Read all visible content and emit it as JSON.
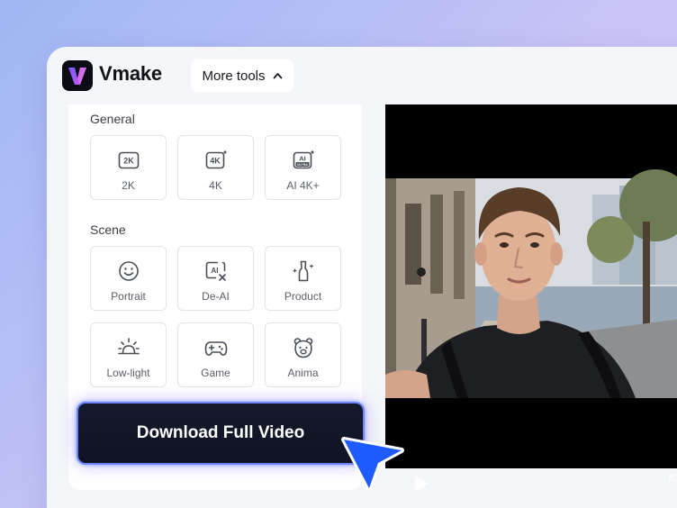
{
  "header": {
    "brand": "Vmake",
    "more_tools_label": "More tools"
  },
  "sections": [
    {
      "label": "General",
      "tiles": [
        {
          "label": "2K",
          "icon": "2k-icon"
        },
        {
          "label": "4K",
          "icon": "4k-icon"
        },
        {
          "label": "AI 4K+",
          "icon": "ai-ultra-icon"
        }
      ]
    },
    {
      "label": "Scene",
      "tiles": [
        {
          "label": "Portrait",
          "icon": "smiley-icon"
        },
        {
          "label": "De-AI",
          "icon": "de-ai-icon"
        },
        {
          "label": "Product",
          "icon": "product-icon"
        },
        {
          "label": "Low-light",
          "icon": "sunrise-icon"
        },
        {
          "label": "Game",
          "icon": "gamepad-icon"
        },
        {
          "label": "Anima",
          "icon": "bear-icon"
        }
      ]
    }
  ],
  "icon_text": {
    "k2": "2K",
    "k4": "4K",
    "ai": "AI",
    "ultra": "ULTRA"
  },
  "download_label": "Download Full Video",
  "colors": {
    "accent": "#1f5cff",
    "button_bg": "#121829",
    "glow": "#8b6dff"
  }
}
